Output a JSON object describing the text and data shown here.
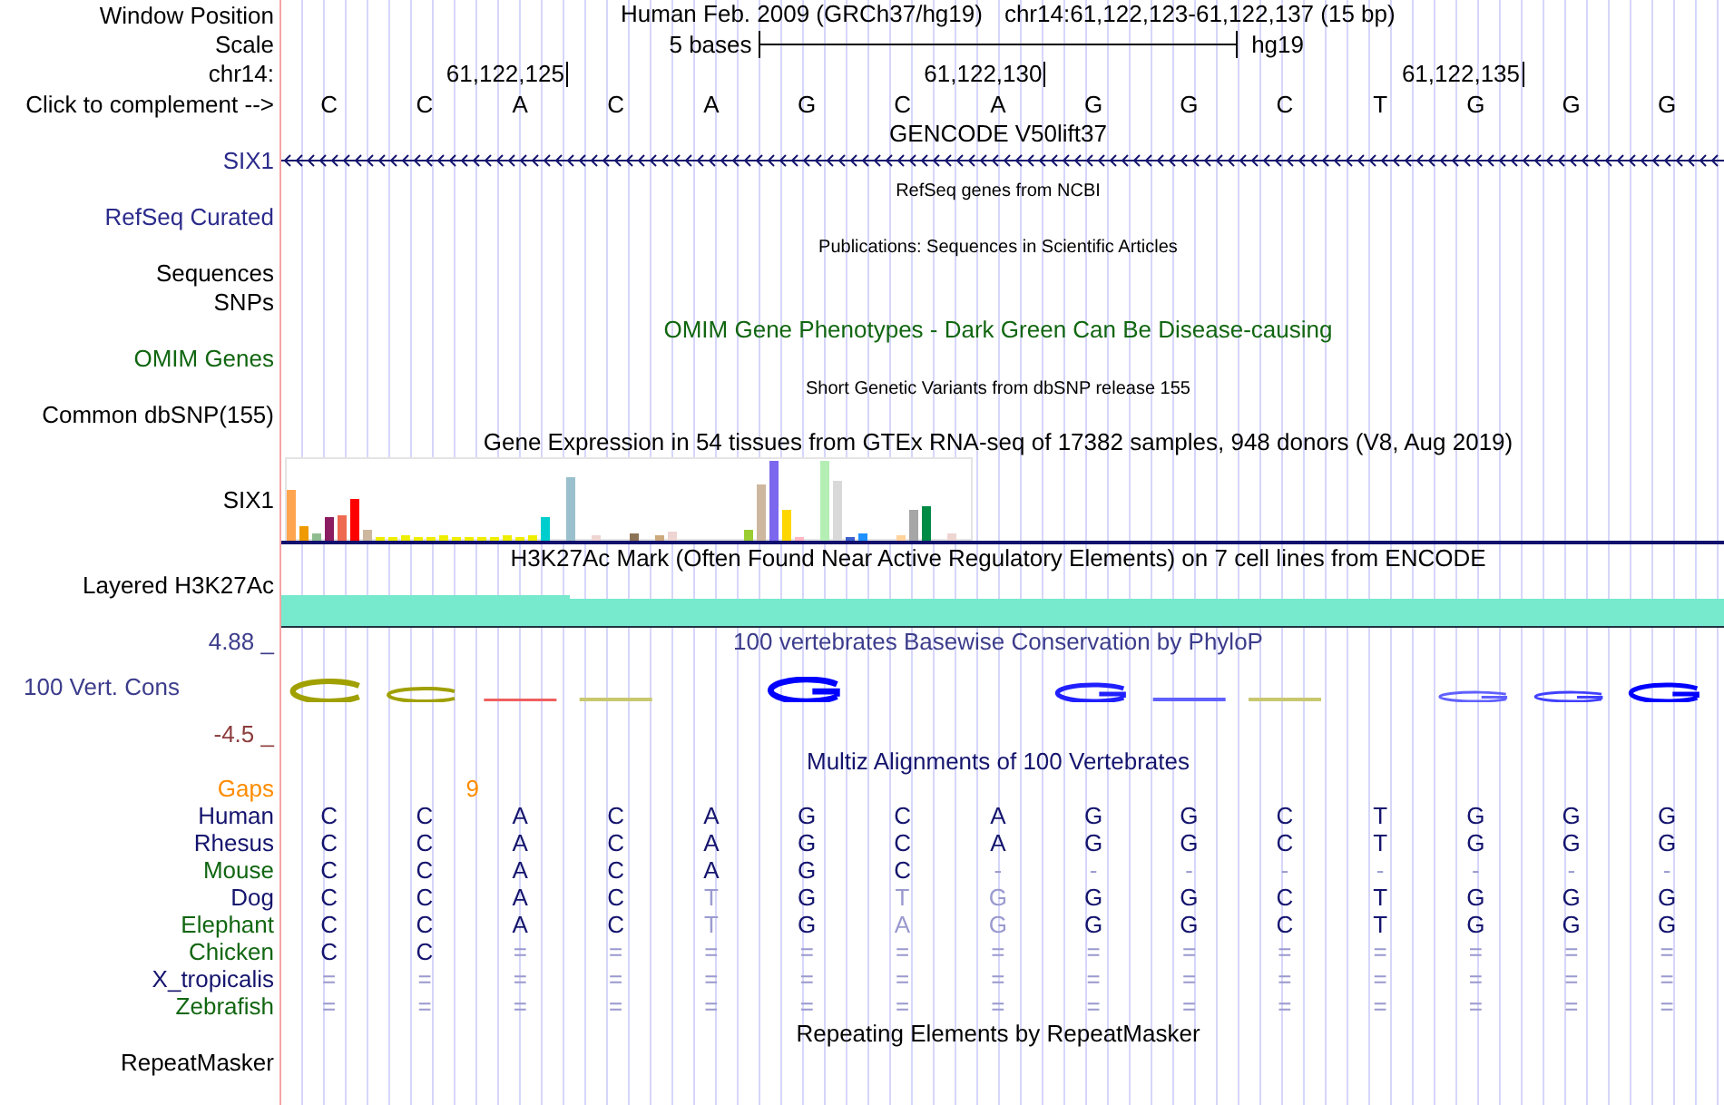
{
  "ruler": {
    "window_label": "Window Position",
    "assembly": "Human Feb. 2009 (GRCh37/hg19)",
    "range": "chr14:61,122,123-61,122,137 (15 bp)",
    "scale_label": "Scale",
    "scale_span": "5 bases",
    "scale_db": "hg19",
    "chrom_label": "chr14:",
    "ticks": [
      "61,122,125",
      "61,122,130",
      "61,122,135"
    ],
    "complement_label": "Click to complement -->",
    "bases": [
      "C",
      "C",
      "A",
      "C",
      "A",
      "G",
      "C",
      "A",
      "G",
      "G",
      "C",
      "T",
      "G",
      "G",
      "G"
    ]
  },
  "tracks": [
    {
      "kind": "gene",
      "title": {
        "text": "GENCODE V50lift37",
        "color": "#000000",
        "small": false
      },
      "labels": [
        {
          "text": "SIX1",
          "color": "#2b2b8c"
        }
      ],
      "minus_strand": true
    },
    {
      "kind": "empty",
      "title": {
        "text": "RefSeq genes from NCBI",
        "color": "#000000",
        "small": true
      },
      "labels": [
        {
          "text": "RefSeq Curated",
          "color": "#2b2b8c"
        }
      ]
    },
    {
      "kind": "empty",
      "title": {
        "text": "Publications: Sequences in Scientific Articles",
        "color": "#000000",
        "small": true
      },
      "labels": [
        {
          "text": "Sequences",
          "color": "#000000"
        },
        {
          "text": "SNPs",
          "color": "#000000"
        }
      ]
    },
    {
      "kind": "empty",
      "title": {
        "text": "OMIM Gene Phenotypes - Dark Green Can Be Disease-causing",
        "color": "#116611",
        "small": false
      },
      "labels": [
        {
          "text": "OMIM Genes",
          "color": "#116611"
        }
      ]
    },
    {
      "kind": "empty",
      "title": {
        "text": "Short Genetic Variants from dbSNP release 155",
        "color": "#000000",
        "small": true
      },
      "labels": [
        {
          "text": "Common dbSNP(155)",
          "color": "#000000"
        }
      ]
    },
    {
      "kind": "bar_chart",
      "title": {
        "text": "Gene Expression in 54 tissues from GTEx RNA-seq of 17382 samples, 948 donors (V8, Aug 2019)",
        "color": "#000000",
        "small": false
      },
      "labels": [
        {
          "text": "SIX1",
          "color": "#000000"
        }
      ]
    },
    {
      "kind": "signal",
      "title": {
        "text": "H3K27Ac Mark (Often Found Near Active Regulatory Elements) on 7 cell lines from ENCODE",
        "color": "#000000",
        "small": false
      },
      "labels": [
        {
          "text": "Layered H3K27Ac",
          "color": "#000000"
        }
      ]
    },
    {
      "kind": "conservation",
      "title": {
        "text": "100 vertebrates Basewise Conservation by PhyloP",
        "color": "#3c3c8c",
        "small": false
      },
      "labels": [
        {
          "text": "4.88 _",
          "color": "#3c3c8c"
        },
        {
          "text": "100 Vert. Cons",
          "color": "#3c3c8c"
        },
        {
          "text": "-4.5 _",
          "color": "#8c3c3c"
        }
      ]
    },
    {
      "kind": "alignment",
      "title": {
        "text": "Multiz Alignments of 100 Vertebrates",
        "color": "#14146e",
        "small": false
      },
      "gaps": {
        "label": "Gaps",
        "color": "#ff8c00"
      },
      "species": [
        {
          "name": "Human",
          "color": "#14146e",
          "bases": [
            {
              "base": "C",
              "faded": false
            },
            {
              "base": "C",
              "faded": false,
              "gap_after": "9"
            },
            {
              "base": "A",
              "faded": false
            },
            {
              "base": "C",
              "faded": false
            },
            {
              "base": "A",
              "faded": false
            },
            {
              "base": "G",
              "faded": false
            },
            {
              "base": "C",
              "faded": false
            },
            {
              "base": "A",
              "faded": false
            },
            {
              "base": "G",
              "faded": false
            },
            {
              "base": "G",
              "faded": false
            },
            {
              "base": "C",
              "faded": false
            },
            {
              "base": "T",
              "faded": false
            },
            {
              "base": "G",
              "faded": false
            },
            {
              "base": "G",
              "faded": false
            },
            {
              "base": "G",
              "faded": false
            }
          ]
        },
        {
          "name": "Rhesus",
          "color": "#14146e",
          "bases": [
            {
              "base": "C",
              "faded": false
            },
            {
              "base": "C",
              "faded": false
            },
            {
              "base": "A",
              "faded": false
            },
            {
              "base": "C",
              "faded": false
            },
            {
              "base": "A",
              "faded": false
            },
            {
              "base": "G",
              "faded": false
            },
            {
              "base": "C",
              "faded": false
            },
            {
              "base": "A",
              "faded": false
            },
            {
              "base": "G",
              "faded": false
            },
            {
              "base": "G",
              "faded": false
            },
            {
              "base": "C",
              "faded": false
            },
            {
              "base": "T",
              "faded": false
            },
            {
              "base": "G",
              "faded": false
            },
            {
              "base": "G",
              "faded": false
            },
            {
              "base": "G",
              "faded": false
            }
          ]
        },
        {
          "name": "Mouse",
          "color": "#116611",
          "bases": [
            {
              "base": "C",
              "faded": false
            },
            {
              "base": "C",
              "faded": false
            },
            {
              "base": "A",
              "faded": false
            },
            {
              "base": "C",
              "faded": false
            },
            {
              "base": "A",
              "faded": false
            },
            {
              "base": "G",
              "faded": false
            },
            {
              "base": "C",
              "faded": false
            },
            {
              "base": "-",
              "faded": true
            },
            {
              "base": "-",
              "faded": true
            },
            {
              "base": "-",
              "faded": true
            },
            {
              "base": "-",
              "faded": true
            },
            {
              "base": "-",
              "faded": true
            },
            {
              "base": "-",
              "faded": true
            },
            {
              "base": "-",
              "faded": true
            },
            {
              "base": "-",
              "faded": true
            }
          ]
        },
        {
          "name": "Dog",
          "color": "#14146e",
          "bases": [
            {
              "base": "C",
              "faded": false
            },
            {
              "base": "C",
              "faded": false
            },
            {
              "base": "A",
              "faded": false
            },
            {
              "base": "C",
              "faded": false
            },
            {
              "base": "T",
              "faded": true
            },
            {
              "base": "G",
              "faded": false
            },
            {
              "base": "T",
              "faded": true
            },
            {
              "base": "G",
              "faded": true
            },
            {
              "base": "G",
              "faded": false
            },
            {
              "base": "G",
              "faded": false
            },
            {
              "base": "C",
              "faded": false
            },
            {
              "base": "T",
              "faded": false
            },
            {
              "base": "G",
              "faded": false
            },
            {
              "base": "G",
              "faded": false
            },
            {
              "base": "G",
              "faded": false
            }
          ]
        },
        {
          "name": "Elephant",
          "color": "#116611",
          "bases": [
            {
              "base": "C",
              "faded": false
            },
            {
              "base": "C",
              "faded": false
            },
            {
              "base": "A",
              "faded": false
            },
            {
              "base": "C",
              "faded": false
            },
            {
              "base": "T",
              "faded": true
            },
            {
              "base": "G",
              "faded": false
            },
            {
              "base": "A",
              "faded": true
            },
            {
              "base": "G",
              "faded": true
            },
            {
              "base": "G",
              "faded": false
            },
            {
              "base": "G",
              "faded": false
            },
            {
              "base": "C",
              "faded": false
            },
            {
              "base": "T",
              "faded": false
            },
            {
              "base": "G",
              "faded": false
            },
            {
              "base": "G",
              "faded": false
            },
            {
              "base": "G",
              "faded": false
            }
          ]
        },
        {
          "name": "Chicken",
          "color": "#116611",
          "bases": [
            {
              "base": "C",
              "faded": false
            },
            {
              "base": "C",
              "faded": false
            },
            {
              "base": "=",
              "faded": true
            },
            {
              "base": "=",
              "faded": true
            },
            {
              "base": "=",
              "faded": true
            },
            {
              "base": "=",
              "faded": true
            },
            {
              "base": "=",
              "faded": true
            },
            {
              "base": "=",
              "faded": true
            },
            {
              "base": "=",
              "faded": true
            },
            {
              "base": "=",
              "faded": true
            },
            {
              "base": "=",
              "faded": true
            },
            {
              "base": "=",
              "faded": true
            },
            {
              "base": "=",
              "faded": true
            },
            {
              "base": "=",
              "faded": true
            },
            {
              "base": "=",
              "faded": true
            }
          ]
        },
        {
          "name": "X_tropicalis",
          "color": "#14146e",
          "bases": [
            {
              "base": "=",
              "faded": true
            },
            {
              "base": "=",
              "faded": true
            },
            {
              "base": "=",
              "faded": true
            },
            {
              "base": "=",
              "faded": true
            },
            {
              "base": "=",
              "faded": true
            },
            {
              "base": "=",
              "faded": true
            },
            {
              "base": "=",
              "faded": true
            },
            {
              "base": "=",
              "faded": true
            },
            {
              "base": "=",
              "faded": true
            },
            {
              "base": "=",
              "faded": true
            },
            {
              "base": "=",
              "faded": true
            },
            {
              "base": "=",
              "faded": true
            },
            {
              "base": "=",
              "faded": true
            },
            {
              "base": "=",
              "faded": true
            },
            {
              "base": "=",
              "faded": true
            }
          ]
        },
        {
          "name": "Zebrafish",
          "color": "#116611",
          "bases": [
            {
              "base": "=",
              "faded": true
            },
            {
              "base": "=",
              "faded": true
            },
            {
              "base": "=",
              "faded": true
            },
            {
              "base": "=",
              "faded": true
            },
            {
              "base": "=",
              "faded": true
            },
            {
              "base": "=",
              "faded": true
            },
            {
              "base": "=",
              "faded": true
            },
            {
              "base": "=",
              "faded": true
            },
            {
              "base": "=",
              "faded": true
            },
            {
              "base": "=",
              "faded": true
            },
            {
              "base": "=",
              "faded": true
            },
            {
              "base": "=",
              "faded": true
            },
            {
              "base": "=",
              "faded": true
            },
            {
              "base": "=",
              "faded": true
            },
            {
              "base": "=",
              "faded": true
            }
          ]
        }
      ]
    },
    {
      "kind": "empty",
      "title": {
        "text": "Repeating Elements by RepeatMasker",
        "color": "#000000",
        "small": false
      },
      "labels": [
        {
          "text": "RepeatMasker",
          "color": "#000000"
        }
      ]
    }
  ]
}
